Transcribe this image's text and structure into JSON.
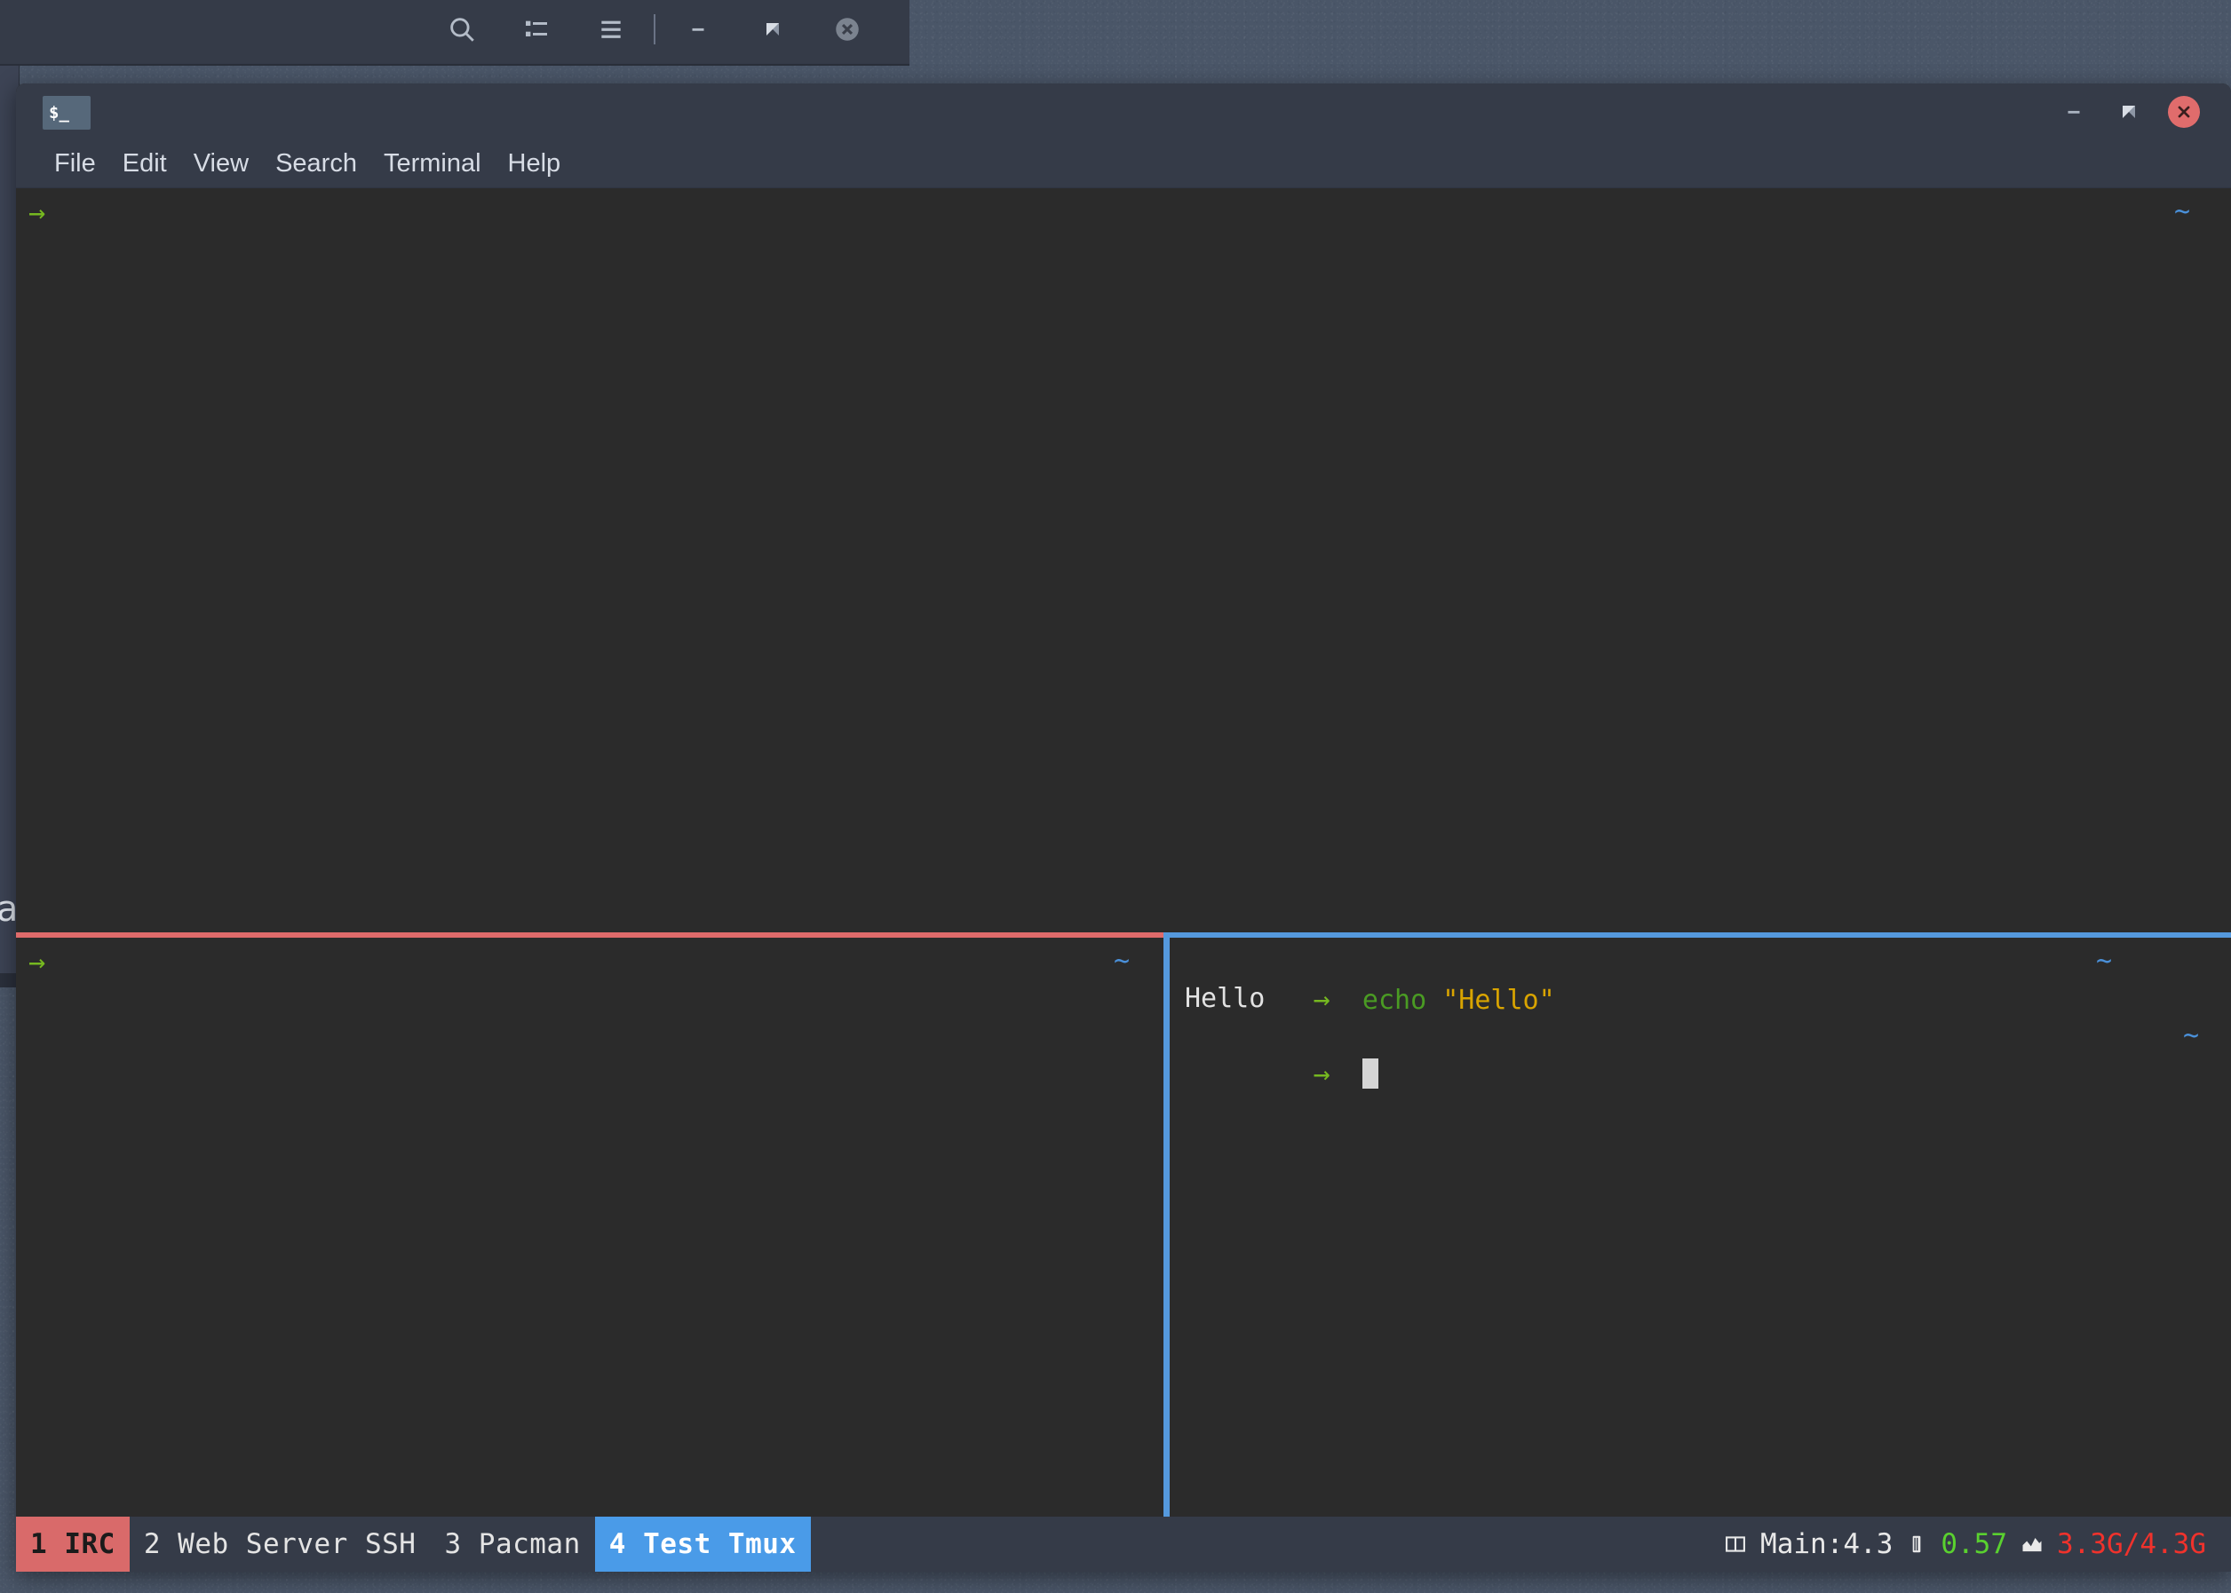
{
  "desktop": {
    "background_color": "#4a5668"
  },
  "background_window": {
    "name": "partially-hidden-window",
    "controls": [
      {
        "name": "search-icon",
        "label": "search"
      },
      {
        "name": "list-view-icon",
        "label": "list view"
      },
      {
        "name": "hamburger-menu-icon",
        "label": "menu"
      },
      {
        "name": "minimize-icon",
        "label": "minimize"
      },
      {
        "name": "restore-icon",
        "label": "restore"
      },
      {
        "name": "close-icon",
        "label": "close"
      }
    ],
    "left_sliver_text": "a"
  },
  "terminal_window": {
    "app_icon_label": "$_",
    "titlebar": {
      "minimize_label": "–",
      "restore_label": "⤡",
      "close_label": "✕"
    },
    "menu": [
      {
        "label": "File"
      },
      {
        "label": "Edit"
      },
      {
        "label": "View"
      },
      {
        "label": "Search"
      },
      {
        "label": "Terminal"
      },
      {
        "label": "Help"
      }
    ]
  },
  "tmux": {
    "panes": [
      {
        "id": "top",
        "active": false,
        "border_color": "#df6b6b",
        "prompt": "→",
        "right_marker": "~",
        "lines": []
      },
      {
        "id": "bottom-left",
        "active": false,
        "border_color": "#df6b6b",
        "prompt": "→",
        "right_marker": "~",
        "lines": []
      },
      {
        "id": "bottom-right",
        "active": true,
        "border_color": "#5599dd",
        "prompt": "→",
        "right_marker": "~",
        "command": "echo",
        "command_arg": "\"Hello\"",
        "output": "Hello",
        "cursor_prompt": "→"
      }
    ],
    "status_bar": {
      "windows": [
        {
          "label": "1 IRC",
          "state": "alert",
          "bg": "#d96a6a"
        },
        {
          "label": "2 Web Server SSH",
          "state": "inactive",
          "bg": "#353b48"
        },
        {
          "label": "3 Pacman",
          "state": "inactive",
          "bg": "#353b48"
        },
        {
          "label": "4 Test Tmux",
          "state": "active",
          "bg": "#4a9be8"
        }
      ],
      "right": {
        "session_icon": "panes-icon",
        "session_label": "Main:4.3",
        "cpu_icon": "cpu-chip-icon",
        "cpu_value": "0.57",
        "cpu_color": "#5ad12f",
        "mem_icon": "memory-graph-icon",
        "mem_value": "3.3G/4.3G",
        "mem_color": "#f0322c"
      }
    }
  }
}
